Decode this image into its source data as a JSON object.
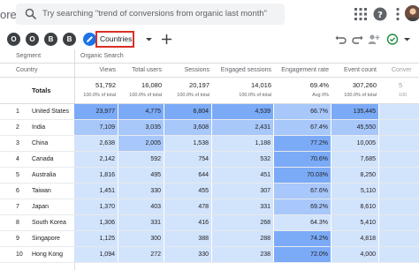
{
  "app": {
    "name_fragment": "ore"
  },
  "search": {
    "placeholder": "Try searching \"trend of conversions from organic last month\""
  },
  "toolbar": {
    "comparison_chips": [
      "O",
      "O",
      "B",
      "B"
    ],
    "active_tab": "Countries"
  },
  "table": {
    "header": {
      "dimension_group": "Segment",
      "segment_name": "Organic Search",
      "dimension_col": "Country"
    },
    "columns": [
      "Views",
      "Total users",
      "Sessions",
      "Engaged sessions",
      "Engagement rate",
      "Event count",
      "Conver"
    ],
    "totals": {
      "label": "Totals",
      "values": [
        "51,792",
        "16,080",
        "20,197",
        "14,016",
        "69.4%",
        "307,260",
        "5"
      ],
      "subs": [
        "100.0% of total",
        "100.0% of total",
        "100.0% of total",
        "100.0% of total",
        "Avg 0%",
        "100.0% of total",
        "100"
      ]
    },
    "rows": [
      {
        "rank": "1",
        "country": "United States",
        "values": [
          "23,977",
          "4,775",
          "6,804",
          "4,539",
          "66.7%",
          "135,445",
          ""
        ]
      },
      {
        "rank": "2",
        "country": "India",
        "values": [
          "7,109",
          "3,035",
          "3,608",
          "2,431",
          "67.4%",
          "45,550",
          ""
        ]
      },
      {
        "rank": "3",
        "country": "China",
        "values": [
          "2,638",
          "2,005",
          "1,538",
          "1,188",
          "77.2%",
          "10,005",
          ""
        ]
      },
      {
        "rank": "4",
        "country": "Canada",
        "values": [
          "2,142",
          "592",
          "754",
          "532",
          "70.6%",
          "7,685",
          ""
        ]
      },
      {
        "rank": "5",
        "country": "Australia",
        "values": [
          "1,816",
          "495",
          "644",
          "451",
          "70.03%",
          "8,250",
          ""
        ]
      },
      {
        "rank": "6",
        "country": "Taiwan",
        "values": [
          "1,451",
          "330",
          "455",
          "307",
          "67.6%",
          "5,110",
          ""
        ]
      },
      {
        "rank": "7",
        "country": "Japan",
        "values": [
          "1,370",
          "403",
          "478",
          "331",
          "69.2%",
          "8,610",
          ""
        ]
      },
      {
        "rank": "8",
        "country": "South Korea",
        "values": [
          "1,306",
          "331",
          "416",
          "268",
          "64.3%",
          "5,410",
          ""
        ]
      },
      {
        "rank": "9",
        "country": "Singapore",
        "values": [
          "1,125",
          "300",
          "388",
          "288",
          "74.2%",
          "4,818",
          ""
        ]
      },
      {
        "rank": "10",
        "country": "Hong Kong",
        "values": [
          "1,094",
          "272",
          "330",
          "238",
          "72.0%",
          "4,000",
          ""
        ]
      }
    ]
  },
  "colors": {
    "accent": "#1a73e8",
    "highlight_border": "#d93025",
    "heat_strong": "#7baaf7",
    "heat_mid": "#a8c7fa",
    "heat_light": "#d2e3fc"
  }
}
